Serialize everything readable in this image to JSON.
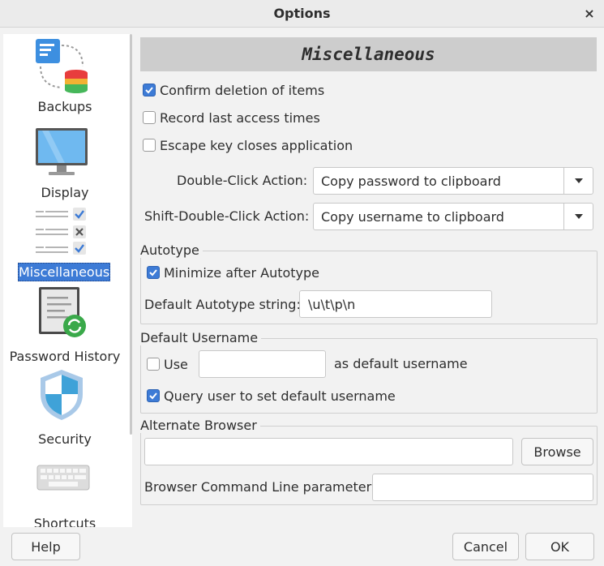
{
  "window": {
    "title": "Options",
    "close_glyph": "×"
  },
  "sidebar": {
    "items": [
      {
        "label": "Backups",
        "icon": "backups-icon"
      },
      {
        "label": "Display",
        "icon": "display-monitor-icon"
      },
      {
        "label": "Miscellaneous",
        "icon": "checklist-icon",
        "selected": true
      },
      {
        "label": "Password History",
        "icon": "document-refresh-icon"
      },
      {
        "label": "Security",
        "icon": "shield-icon"
      },
      {
        "label": "Shortcuts",
        "icon": "keyboard-icon"
      }
    ]
  },
  "panel": {
    "title": "Miscellaneous",
    "options": [
      {
        "label": "Confirm deletion of items",
        "checked": true
      },
      {
        "label": "Record last access times",
        "checked": false
      },
      {
        "label": "Escape key closes application",
        "checked": false
      }
    ],
    "double_click": {
      "label": "Double-Click Action:",
      "value": "Copy password to clipboard"
    },
    "shift_double_click": {
      "label": "Shift-Double-Click Action:",
      "value": "Copy username to clipboard"
    },
    "autotype": {
      "group_label": "Autotype",
      "minimize_label": "Minimize after Autotype",
      "minimize_checked": true,
      "string_label": "Default Autotype string:",
      "string_value": "\\u\\t\\p\\n"
    },
    "default_username": {
      "group_label": "Default Username",
      "use_label": "Use",
      "use_checked": false,
      "username_value": "",
      "suffix_label": "as default username",
      "query_label": "Query user to set default username",
      "query_checked": true
    },
    "alternate_browser": {
      "group_label": "Alternate Browser",
      "browser_value": "",
      "browse_label": "Browse",
      "params_label": "Browser Command Line parameters",
      "params_value": ""
    }
  },
  "footer": {
    "help_label": "Help",
    "cancel_label": "Cancel",
    "ok_label": "OK"
  },
  "colors": {
    "accent": "#3d7bd6",
    "header_bg": "#cdcdcd",
    "window_bg": "#f2f2f2"
  }
}
